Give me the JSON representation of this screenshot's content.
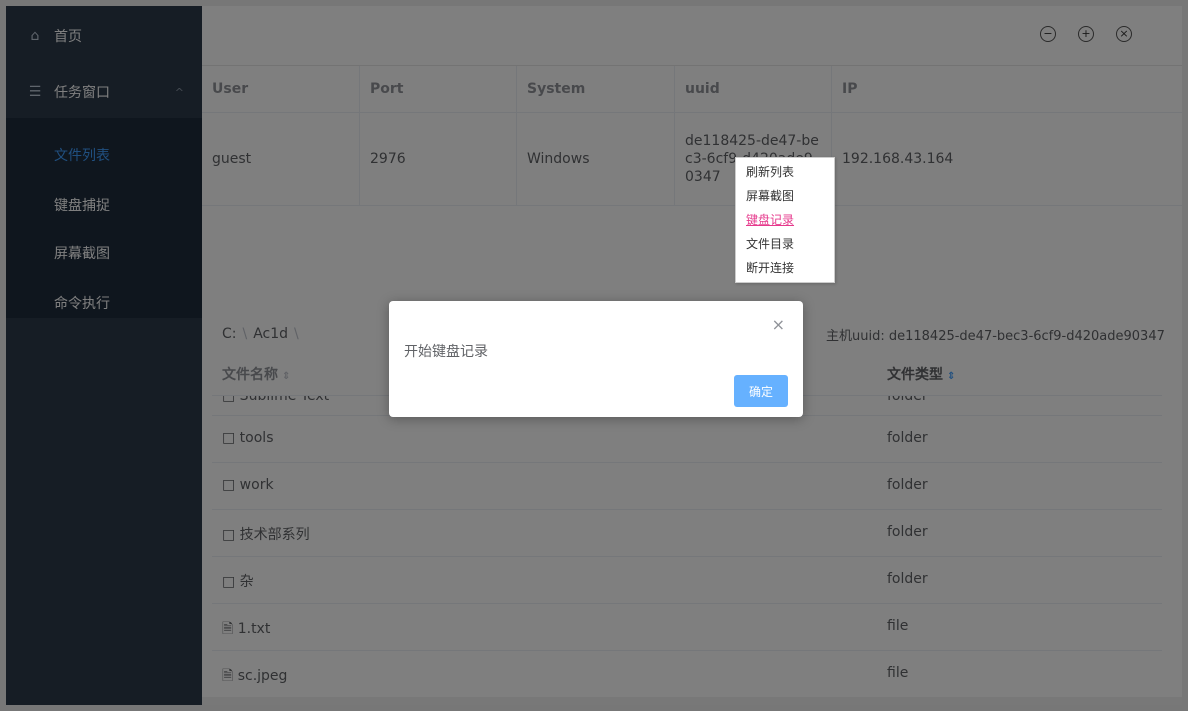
{
  "sidebar": {
    "home_label": "首页",
    "task_window_label": "任务窗口",
    "items": [
      {
        "label": "文件列表"
      },
      {
        "label": "键盘捕捉"
      },
      {
        "label": "屏幕截图"
      },
      {
        "label": "命令执行"
      }
    ]
  },
  "header": {
    "minimize_glyph": "−",
    "maximize_glyph": "+",
    "close_glyph": "×"
  },
  "clients_table": {
    "columns": [
      "User",
      "Port",
      "System",
      "uuid",
      "IP"
    ],
    "rows": [
      {
        "user": "guest",
        "port": "2976",
        "system": "Windows",
        "uuid": "de118425-de47-bec3-6cf9-d420ade90347",
        "ip": "192.168.43.164"
      }
    ]
  },
  "context_menu": {
    "items": [
      "刷新列表",
      "屏幕截图",
      "键盘记录",
      "文件目录",
      "断开连接"
    ]
  },
  "file_browser": {
    "breadcrumb": [
      "C:",
      "Ac1d"
    ],
    "host_uuid_label": "主机uuid: de118425-de47-bec3-6cf9-d420ade90347",
    "columns": [
      "文件名称",
      "文件类型"
    ],
    "rows": [
      {
        "name": "□ Sublime Text",
        "type": "folder"
      },
      {
        "name": "□ tools",
        "type": "folder"
      },
      {
        "name": "□ work",
        "type": "folder"
      },
      {
        "name": "□ 技术部系列",
        "type": "folder"
      },
      {
        "name": "□ 杂",
        "type": "folder"
      },
      {
        "name": "🗎 1.txt",
        "type": "file"
      },
      {
        "name": "🗎 sc.jpeg",
        "type": "file"
      }
    ]
  },
  "dialog": {
    "message": "开始键盘记录",
    "ok_label": "确定",
    "close_glyph": "×"
  },
  "colors": {
    "sidebar_bg": "#2d3a4b",
    "active_blue": "#409eff",
    "highlight_pink": "#e6398c"
  }
}
